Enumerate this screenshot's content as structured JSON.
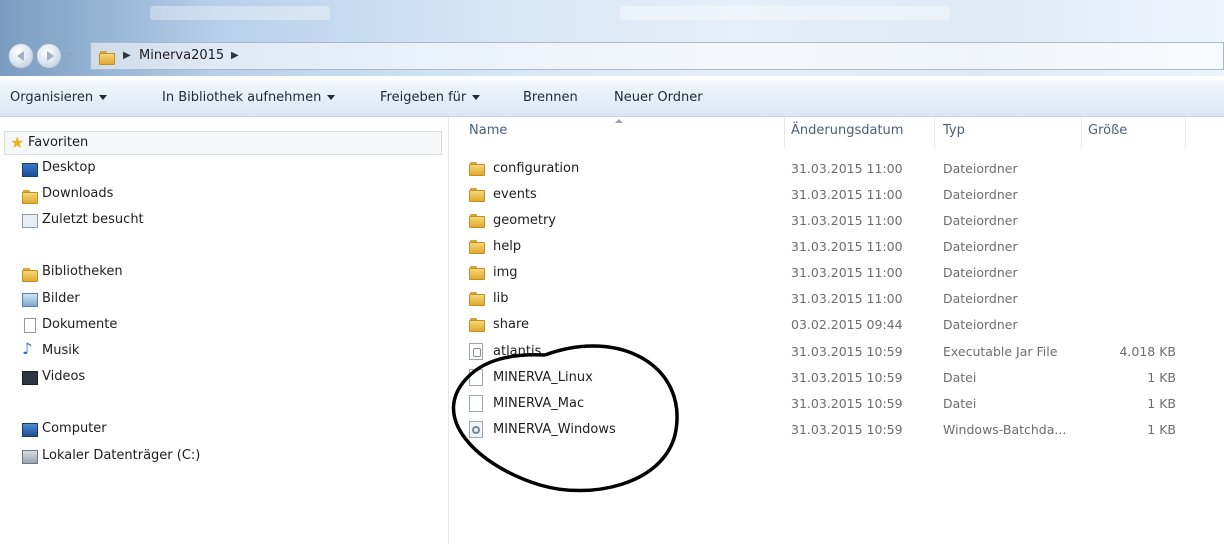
{
  "window": {
    "breadcrumb": "Minerva2015"
  },
  "toolbar": {
    "items": [
      {
        "label": "Organisieren",
        "dropdown": true
      },
      {
        "label": "In Bibliothek aufnehmen",
        "dropdown": true
      },
      {
        "label": "Freigeben für",
        "dropdown": true
      },
      {
        "label": "Brennen",
        "dropdown": false
      },
      {
        "label": "Neuer Ordner",
        "dropdown": false
      }
    ]
  },
  "nav": {
    "favorites": {
      "label": "Favoriten",
      "items": [
        {
          "label": "Desktop",
          "icon": "desktop-icon"
        },
        {
          "label": "Downloads",
          "icon": "downloads-icon"
        },
        {
          "label": "Zuletzt besucht",
          "icon": "recent-places-icon"
        }
      ]
    },
    "libraries": {
      "label": "Bibliotheken",
      "items": [
        {
          "label": "Bilder",
          "icon": "pictures-icon"
        },
        {
          "label": "Dokumente",
          "icon": "documents-icon"
        },
        {
          "label": "Musik",
          "icon": "music-icon"
        },
        {
          "label": "Videos",
          "icon": "videos-icon"
        }
      ]
    },
    "computer": {
      "label": "Computer",
      "items": [
        {
          "label": "Lokaler Datenträger (C:)",
          "icon": "local-drive-icon"
        }
      ]
    }
  },
  "columns": {
    "name": "Name",
    "date": "Änderungsdatum",
    "type": "Typ",
    "size": "Größe"
  },
  "files": [
    {
      "name": "configuration",
      "date": "31.03.2015 11:00",
      "type": "Dateiordner",
      "size": "",
      "icon": "folder-icon"
    },
    {
      "name": "events",
      "date": "31.03.2015 11:00",
      "type": "Dateiordner",
      "size": "",
      "icon": "folder-icon"
    },
    {
      "name": "geometry",
      "date": "31.03.2015 11:00",
      "type": "Dateiordner",
      "size": "",
      "icon": "folder-icon"
    },
    {
      "name": "help",
      "date": "31.03.2015 11:00",
      "type": "Dateiordner",
      "size": "",
      "icon": "folder-icon"
    },
    {
      "name": "img",
      "date": "31.03.2015 11:00",
      "type": "Dateiordner",
      "size": "",
      "icon": "folder-icon"
    },
    {
      "name": "lib",
      "date": "31.03.2015 11:00",
      "type": "Dateiordner",
      "size": "",
      "icon": "folder-icon"
    },
    {
      "name": "share",
      "date": "03.02.2015 09:44",
      "type": "Dateiordner",
      "size": "",
      "icon": "folder-icon"
    },
    {
      "name": "atlantis",
      "date": "31.03.2015 10:59",
      "type": "Executable Jar File",
      "size": "4.018 KB",
      "icon": "jar-file-icon"
    },
    {
      "name": "MINERVA_Linux",
      "date": "31.03.2015 10:59",
      "type": "Datei",
      "size": "1 KB",
      "icon": "file-icon"
    },
    {
      "name": "MINERVA_Mac",
      "date": "31.03.2015 10:59",
      "type": "Datei",
      "size": "1 KB",
      "icon": "file-icon"
    },
    {
      "name": "MINERVA_Windows",
      "date": "31.03.2015 10:59",
      "type": "Windows-Batchda...",
      "size": "1 KB",
      "icon": "batch-file-icon"
    }
  ]
}
